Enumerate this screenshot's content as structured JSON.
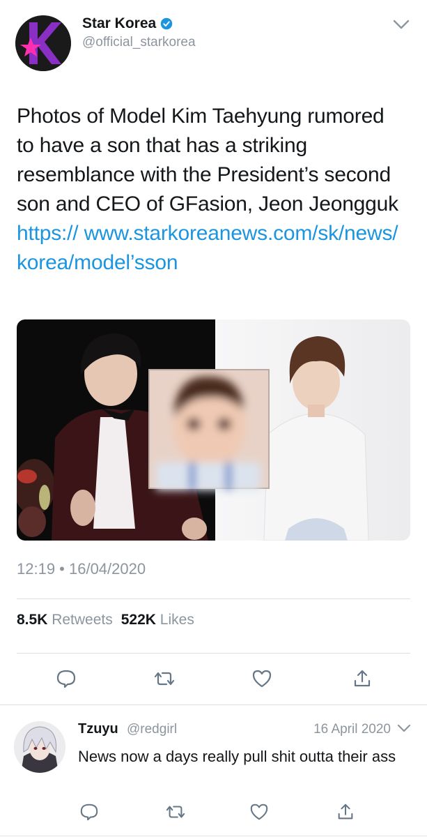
{
  "tweet": {
    "author_name": "Star Korea",
    "handle": "@official_starkorea",
    "text": "Photos of Model Kim Taehyung rumored to have a son that has a striking resemblance with the President’s second son and CEO of GFasion, Jeon Jeongguk ",
    "link": "https:// www.starkoreanews.com/sk/news/ korea/model’sson",
    "timestamp": "12:19 • 16/04/2020",
    "retweets_count": "8.5K",
    "retweets_label": "Retweets",
    "likes_count": "522K",
    "likes_label": "Likes",
    "icons": {
      "avatar": "star-k-logo",
      "verified": "verified-badge-icon",
      "menu": "chevron-down-icon",
      "actions": [
        "reply-icon",
        "retweet-icon",
        "like-icon",
        "share-icon"
      ]
    }
  },
  "reply": {
    "author_name": "Tzuyu",
    "handle": "@redgirl",
    "date": "16 April 2020",
    "text": "News now a days really pull shit outta their ass"
  },
  "colors": {
    "accent": "#1b95e0",
    "muted_text": "#8c959e",
    "logo_purple": "#8a2fc4",
    "logo_pink": "#ff2fb0"
  }
}
